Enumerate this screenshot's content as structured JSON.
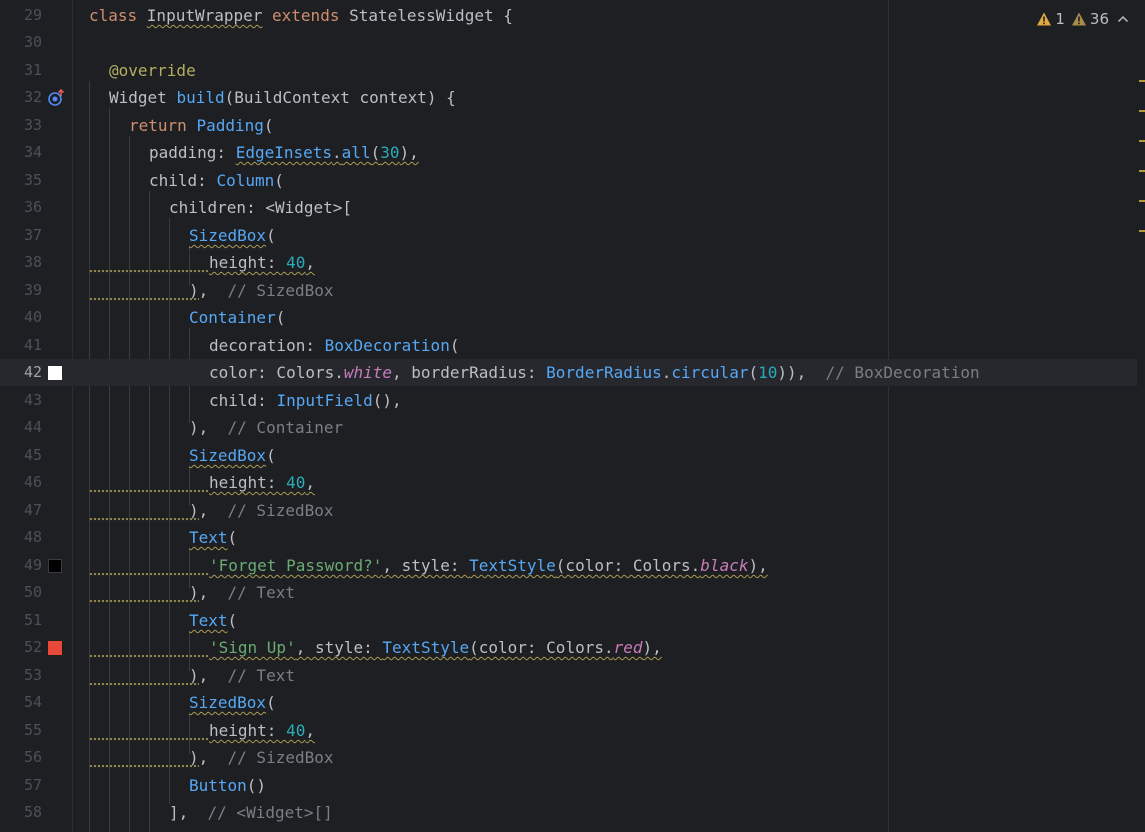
{
  "editor": {
    "inspections": {
      "warnings_count": "1",
      "weak_warnings_count": "36",
      "warning_color": "#e2a93f"
    },
    "colors": {
      "marker_white": "#ffffff",
      "marker_black": "#000000",
      "marker_red": "#e84a3a"
    }
  },
  "lines": [
    {
      "number": "29"
    },
    {
      "number": "30"
    },
    {
      "number": "31"
    },
    {
      "number": "32"
    },
    {
      "number": "33"
    },
    {
      "number": "34"
    },
    {
      "number": "35"
    },
    {
      "number": "36"
    },
    {
      "number": "37"
    },
    {
      "number": "38"
    },
    {
      "number": "39"
    },
    {
      "number": "40"
    },
    {
      "number": "41"
    },
    {
      "number": "42"
    },
    {
      "number": "43"
    },
    {
      "number": "44"
    },
    {
      "number": "45"
    },
    {
      "number": "46"
    },
    {
      "number": "47"
    },
    {
      "number": "48"
    },
    {
      "number": "49"
    },
    {
      "number": "50"
    },
    {
      "number": "51"
    },
    {
      "number": "52"
    },
    {
      "number": "53"
    },
    {
      "number": "54"
    },
    {
      "number": "55"
    },
    {
      "number": "56"
    },
    {
      "number": "57"
    },
    {
      "number": "58"
    }
  ],
  "tokens": {
    "l29": {
      "kw1": "class ",
      "cls": "InputWrapper",
      "kw2": " extends ",
      "base": "StatelessWidget",
      "rest": " {"
    },
    "l31": {
      "ann": "@override"
    },
    "l32": {
      "ty": "Widget ",
      "fn": "build",
      "rest": "(BuildContext context) {"
    },
    "l33": {
      "kw": "return ",
      "ty": "Padding",
      "rest": "("
    },
    "l34": {
      "a": "padding: ",
      "ty": "EdgeInsets",
      "dot": ".",
      "fn": "all",
      "p": "(",
      "num": "30",
      "rest": "),"
    },
    "l35": {
      "a": "child: ",
      "ty": "Column",
      "rest": "("
    },
    "l36": {
      "a": "children: <Widget>["
    },
    "l37": {
      "ty": "SizedBox",
      "rest": "("
    },
    "l38": {
      "a": "height: ",
      "num": "40",
      "rest": ","
    },
    "l39": {
      "a": "),  ",
      "com": "// SizedBox"
    },
    "l40": {
      "ty": "Container",
      "rest": "("
    },
    "l41": {
      "a": "decoration: ",
      "ty": "BoxDecoration",
      "rest": "("
    },
    "l42": {
      "a": "color: Colors.",
      "it": "white",
      "b": ", borderRadius: ",
      "ty": "BorderRadius",
      "dot": ".",
      "fn": "circular",
      "p": "(",
      "num": "10",
      "c": ")),  ",
      "com": "// BoxDecoration"
    },
    "l43": {
      "a": "child: ",
      "ty": "InputField",
      "rest": "(),"
    },
    "l44": {
      "a": "),  ",
      "com": "// Container"
    },
    "l45": {
      "ty": "SizedBox",
      "rest": "("
    },
    "l46": {
      "a": "height: ",
      "num": "40",
      "rest": ","
    },
    "l47": {
      "a": "),  ",
      "com": "// SizedBox"
    },
    "l48": {
      "ty": "Text",
      "rest": "("
    },
    "l49": {
      "str": "'Forget Password?'",
      "a": ", style: ",
      "ty": "TextStyle",
      "b": "(color: Colors.",
      "it": "black",
      "c": "),"
    },
    "l50": {
      "a": "),  ",
      "com": "// Text"
    },
    "l51": {
      "ty": "Text",
      "rest": "("
    },
    "l52": {
      "str": "'Sign Up'",
      "a": ", style: ",
      "ty": "TextStyle",
      "b": "(color: Colors.",
      "it": "red",
      "c": "),"
    },
    "l53": {
      "a": "),  ",
      "com": "// Text"
    },
    "l54": {
      "ty": "SizedBox",
      "rest": "("
    },
    "l55": {
      "a": "height: ",
      "num": "40",
      "rest": ","
    },
    "l56": {
      "a": "),  ",
      "com": "// SizedBox"
    },
    "l57": {
      "ty": "Button",
      "rest": "()"
    },
    "l58": {
      "a": "],  ",
      "com": "// <Widget>[]"
    }
  }
}
